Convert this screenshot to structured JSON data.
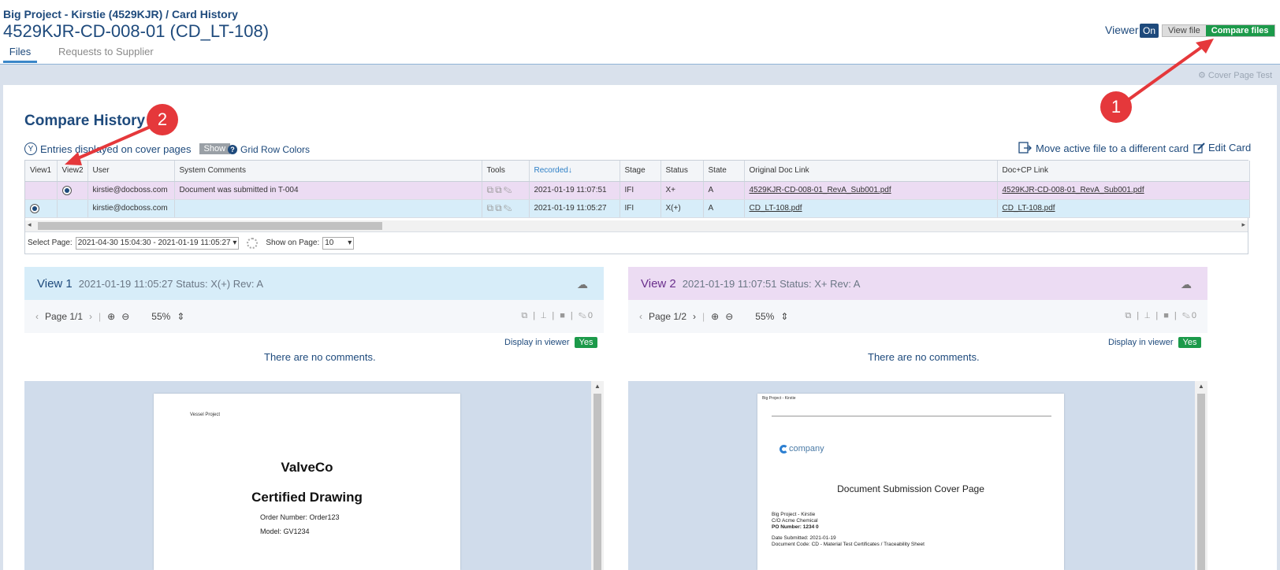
{
  "header": {
    "breadcrumb": "Big Project - Kirstie (4529KJR) / Card History",
    "title": "4529KJR-CD-008-01 (CD_LT-108)",
    "tabs": [
      "Files",
      "Requests to Supplier"
    ],
    "viewer_label": "Viewer",
    "viewer_state": "On",
    "view_file": "View file",
    "compare_files": "Compare files"
  },
  "cover_page_test": "Cover Page Test",
  "compare": {
    "title": "Compare History",
    "entries_label": "Entries displayed on cover pages",
    "y_badge": "Y",
    "show_label": "Show",
    "grid_row_colors": "Grid Row Colors",
    "move_file": "Move active file to a different card",
    "edit_card": "Edit Card"
  },
  "grid": {
    "columns": [
      "View1",
      "View2",
      "User",
      "System Comments",
      "Tools",
      "Recorded",
      "Stage",
      "Status",
      "State",
      "Original Doc Link",
      "Doc+CP Link"
    ],
    "sorted_column": "Recorded",
    "rows": [
      {
        "view1": false,
        "view2": true,
        "user": "kirstie@docboss.com",
        "comment": "Document was submitted in T-004",
        "recorded": "2021-01-19 11:07:51",
        "stage": "IFI",
        "status": "X+",
        "state": "A",
        "orig": "4529KJR-CD-008-01_RevA_Sub001.pdf",
        "doccp": "4529KJR-CD-008-01_RevA_Sub001.pdf"
      },
      {
        "view1": true,
        "view2": false,
        "user": "kirstie@docboss.com",
        "comment": "",
        "recorded": "2021-01-19 11:05:27",
        "stage": "IFI",
        "status": "X(+)",
        "state": "A",
        "orig": "CD_LT-108.pdf",
        "doccp": "CD_LT-108.pdf"
      }
    ],
    "select_page_label": "Select Page:",
    "select_page_value": "2021-04-30 15:04:30 - 2021-01-19 11:05:27",
    "show_on_page_label": "Show on Page:",
    "show_on_page_value": "10"
  },
  "view1": {
    "name": "View 1",
    "meta": "2021-01-19 11:05:27 Status: X(+) Rev: A",
    "page": "Page 1/1",
    "zoom": "55%",
    "comment_count": "0",
    "display_label": "Display in viewer",
    "display_value": "Yes",
    "no_comments": "There are no comments.",
    "doc": {
      "header": "Vessel Project",
      "company": "ValveCo",
      "heading": "Certified Drawing",
      "order": "Order Number: Order123",
      "model": "Model: GV1234"
    }
  },
  "view2": {
    "name": "View 2",
    "meta": "2021-01-19 11:07:51 Status: X+ Rev: A",
    "page": "Page 1/2",
    "zoom": "55%",
    "comment_count": "0",
    "display_label": "Display in viewer",
    "display_value": "Yes",
    "no_comments": "There are no comments.",
    "doc": {
      "header": "Big Project - Kirstie",
      "logo": "company",
      "heading": "Document Submission Cover Page",
      "line1": "Big Project - Kirstie",
      "line2": "C/O Acme Chemical",
      "line3": "PO Number: 1234 0",
      "line4": "Date Submitted: 2021-01-19",
      "line5": "Document Code: CD - Material Test Certificates / Traceability Sheet"
    }
  },
  "annotations": [
    "1",
    "2"
  ],
  "colors": {
    "accent": "#1e4a7c",
    "green": "#1c9a4a",
    "annotation": "#e5383b"
  }
}
